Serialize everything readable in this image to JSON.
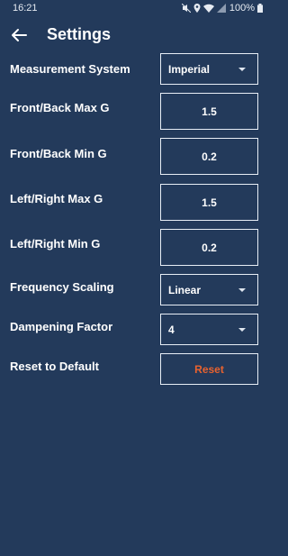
{
  "status_bar": {
    "time": "16:21",
    "battery": "100%"
  },
  "header": {
    "title": "Settings"
  },
  "settings": {
    "measurement_system": {
      "label": "Measurement System",
      "value": "Imperial"
    },
    "front_back_max": {
      "label": "Front/Back Max G",
      "value": "1.5"
    },
    "front_back_min": {
      "label": "Front/Back Min G",
      "value": "0.2"
    },
    "left_right_max": {
      "label": "Left/Right Max G",
      "value": "1.5"
    },
    "left_right_min": {
      "label": "Left/Right Min G",
      "value": "0.2"
    },
    "frequency_scaling": {
      "label": "Frequency Scaling",
      "value": "Linear"
    },
    "dampening_factor": {
      "label": "Dampening Factor",
      "value": "4"
    },
    "reset": {
      "label": "Reset to Default",
      "button": "Reset"
    }
  },
  "colors": {
    "background": "#233a5b",
    "accent_reset": "#e8622f",
    "border": "#e8eef6"
  }
}
